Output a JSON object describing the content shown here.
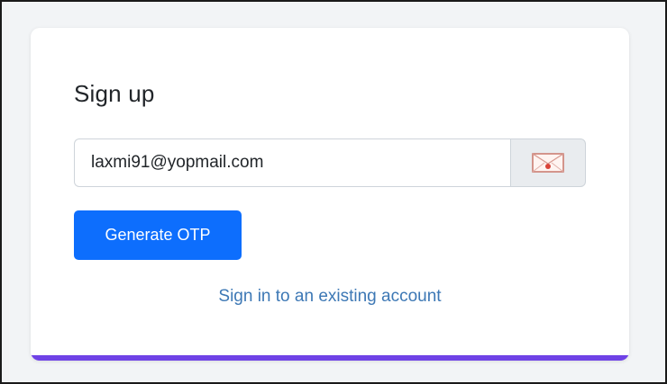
{
  "signup": {
    "title": "Sign up",
    "email_value": "laxmi91@yopmail.com",
    "email_icon": "envelope-icon",
    "generate_otp_label": "Generate OTP",
    "signin_link_label": "Sign in to an existing account"
  },
  "colors": {
    "primary": "#0d6efd",
    "accent_bar": "#6f42e6",
    "link": "#3d78b5"
  }
}
